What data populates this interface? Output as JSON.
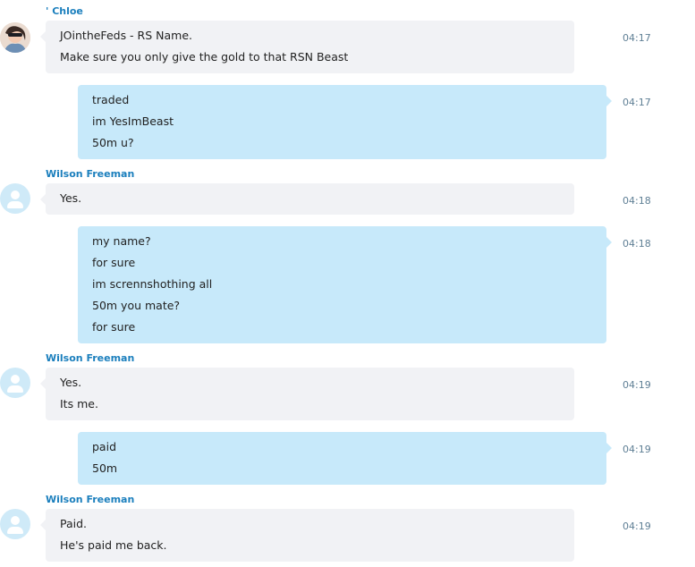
{
  "conversation": {
    "messages": [
      {
        "sender": "' Chloe",
        "direction": "incoming",
        "avatar": "photo-avatar",
        "lines": [
          "JOintheFeds - RS Name.",
          "Make sure you only give the gold to that RSN Beast"
        ],
        "time": "04:17"
      },
      {
        "sender": "",
        "direction": "outgoing",
        "lines": [
          "traded",
          "im YesImBeast",
          "50m u?"
        ],
        "time": "04:17"
      },
      {
        "sender": "Wilson Freeman",
        "direction": "incoming",
        "avatar": "default-user-avatar",
        "lines": [
          "Yes."
        ],
        "time": "04:18"
      },
      {
        "sender": "",
        "direction": "outgoing",
        "lines": [
          "my name?",
          "for sure",
          "im scrennshothing all",
          "50m you mate?",
          "for sure"
        ],
        "time": "04:18"
      },
      {
        "sender": "Wilson Freeman",
        "direction": "incoming",
        "avatar": "default-user-avatar",
        "lines": [
          "Yes.",
          "Its me."
        ],
        "time": "04:19"
      },
      {
        "sender": "",
        "direction": "outgoing",
        "lines": [
          "paid",
          "50m"
        ],
        "time": "04:19"
      },
      {
        "sender": "Wilson Freeman",
        "direction": "incoming",
        "avatar": "default-user-avatar",
        "lines": [
          "Paid.",
          "He's paid me back."
        ],
        "time": "04:19"
      }
    ]
  },
  "colors": {
    "sender_name": "#1b7fbd",
    "incoming_bubble": "#f1f2f5",
    "outgoing_bubble": "#c7e9fa",
    "timestamp": "#5f7f95",
    "avatar_default": "#cfeaf8"
  }
}
